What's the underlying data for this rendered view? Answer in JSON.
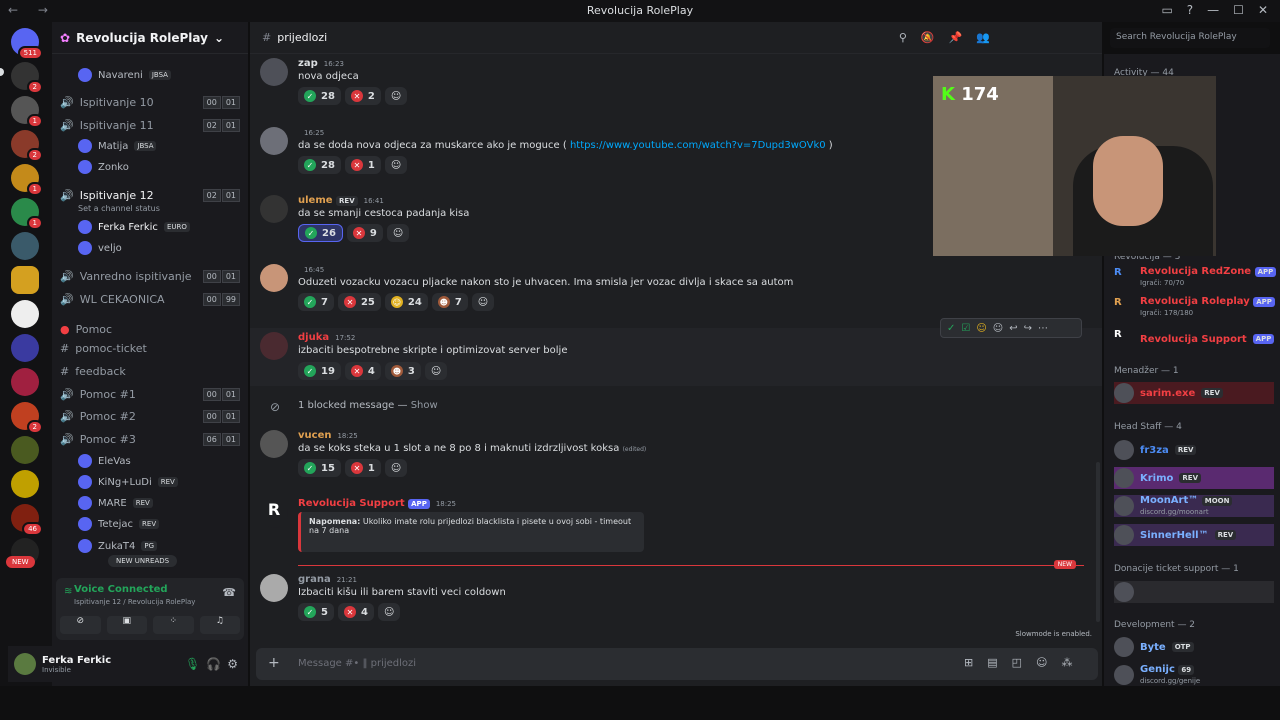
{
  "window": {
    "title": "Revolucija RolePlay"
  },
  "servers": {
    "home_badge": "511",
    "badges": [
      "2",
      "1",
      "2",
      "1",
      "1",
      "2",
      "46"
    ],
    "new_label": "NEW"
  },
  "guild": {
    "name": "Revolucija RolePlay"
  },
  "channels": [
    {
      "name": "Ispitivanje 10",
      "a": "00",
      "b": "01"
    },
    {
      "name": "Ispitivanje 11",
      "a": "02",
      "b": "01"
    },
    {
      "name": "Ispitivanje 12",
      "a": "02",
      "b": "01"
    },
    {
      "name": "Vanredno ispitivanje",
      "a": "00",
      "b": "01"
    },
    {
      "name": "WL CEKAONICA",
      "a": "00",
      "b": "99"
    },
    {
      "name": "Pomoc"
    },
    {
      "name": "pomoc-ticket"
    },
    {
      "name": "feedback"
    },
    {
      "name": "Pomoc #1",
      "a": "00",
      "b": "01"
    },
    {
      "name": "Pomoc #2",
      "a": "00",
      "b": "01"
    },
    {
      "name": "Pomoc #3",
      "a": "06",
      "b": "01"
    }
  ],
  "voice_users": {
    "top1": "Navareni",
    "top1_tag": "JBSA",
    "u1": "Matija",
    "u1_tag": "JBSA",
    "u2": "Zonko",
    "status": "Set a channel status",
    "u3": "Ferka Ferkic",
    "u3_tag": "EURO",
    "u4": "veljo",
    "p1": "EleVas",
    "p2": "KiNg+LuDi",
    "p2_tag": "REV",
    "p3": "MARE",
    "p3_tag": "REV",
    "p4": "Tetejac",
    "p4_tag": "REV",
    "p5": "ZukaT4",
    "p5_tag": "PG",
    "new_unreads": "NEW UNREADS"
  },
  "voice": {
    "status": "Voice Connected",
    "channel": "Ispitivanje 12 / Revolucija RolePlay"
  },
  "user": {
    "name": "Ferka Ferkic",
    "status": "Invisible"
  },
  "channel": {
    "name": "prijedlozi",
    "search_placeholder": "Search Revolucija RolePlay"
  },
  "messages": [
    {
      "author": "zap",
      "time": "16:23",
      "text": "nova odjeca",
      "r1": "28",
      "r2": "2"
    },
    {
      "time": "16:25",
      "text_pre": "da se doda nova odjeca za muskarce ako je moguce ( ",
      "link": "https://www.youtube.com/watch?v=7Dupd3wOVk0",
      "text_post": " )",
      "r1": "28",
      "r2": "1"
    },
    {
      "author": "uleme",
      "tag": "REV",
      "time": "16:41",
      "text": "da se smanji cestoca padanja kisa",
      "r1": "26",
      "r2": "9"
    },
    {
      "time": "16:45",
      "text": "Oduzeti vozacku  vozacu pljacke nakon sto je uhvacen. Ima smisla jer vozac divlja i skace sa autom",
      "r1": "7",
      "r2": "25",
      "r3": "24",
      "r4": "7"
    },
    {
      "author": "djuka",
      "time": "17:52",
      "text": "izbaciti bespotrebne skripte i optimizovat server bolje",
      "r1": "19",
      "r2": "4",
      "r3": "3"
    },
    {
      "blocked": "1 blocked message",
      "show": "Show"
    },
    {
      "author": "vucen",
      "time": "18:25",
      "text": "da se koks steka u 1 slot a ne 8 po 8 i maknuti izdrzljivost koksa",
      "edited": "(edited)",
      "r1": "15",
      "r2": "1"
    },
    {
      "author": "Revolucija Support",
      "app": "APP",
      "time": "18:25",
      "embed_bold": "Napomena:",
      "embed_text": " Ukoliko imate rolu prijedlozi blacklista i pisete u ovoj sobi - timeout na 7 dana"
    },
    {
      "author": "grana",
      "time": "21:21",
      "text": "Izbaciti kišu ili barem staviti veci coldown",
      "r1": "5",
      "r2": "4"
    }
  ],
  "new_marker": "NEW",
  "slowmode": "Slowmode is enabled.",
  "composer": {
    "placeholder": "Message #• ‖ prijedlozi"
  },
  "stream": {
    "counter": "174"
  },
  "members": {
    "activity": "Activity — 44",
    "revolucija": "Revolucija — 3",
    "r1": "Revolucija RedZone",
    "r1_sub": "Igrači: 70/70",
    "r2": "Revolucija Roleplay",
    "r2_sub": "Igrači: 178/180",
    "r3": "Revolucija Support",
    "app": "APP",
    "menadzer": "Menadžer — 1",
    "m1": "sarim.exe",
    "head": "Head Staff — 4",
    "h1": "fr3za",
    "h2": "Krimo",
    "h3": "MoonArt™",
    "h3_tag": "MOON",
    "h3_sub": "discord.gg/moonart",
    "h4": "SinnerHell™",
    "rev": "REV",
    "donacije": "Donacije ticket support — 1",
    "dev": "Development — 2",
    "d1": "Byte",
    "d1_tag": "OTP",
    "d2": "Genijc",
    "d2_tag": "69",
    "d2_sub": "discord.gg/genije"
  }
}
